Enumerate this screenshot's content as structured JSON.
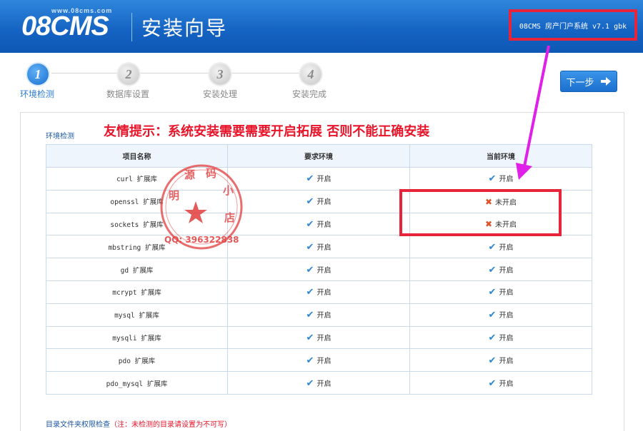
{
  "header": {
    "logo_url_text": "www.08cms.com",
    "logo_text": "08CMS",
    "title": "安装向导",
    "version": "08CMS 房产门户系统 v7.1 gbk"
  },
  "steps": [
    {
      "num": "1",
      "label": "环境检测",
      "active": true
    },
    {
      "num": "2",
      "label": "数据库设置",
      "active": false
    },
    {
      "num": "3",
      "label": "安装处理",
      "active": false
    },
    {
      "num": "4",
      "label": "安装完成",
      "active": false
    }
  ],
  "next_button": {
    "label": "下一步"
  },
  "section": {
    "title": "环境检测",
    "notice": "友情提示：系统安装需要需要开启拓展 否则不能正确安装"
  },
  "table": {
    "headers": [
      "项目名称",
      "要求环境",
      "当前环境"
    ],
    "rows": [
      {
        "name": "curl 扩展库",
        "required": "开启",
        "current": "开启",
        "ok": true
      },
      {
        "name": "openssl 扩展库",
        "required": "开启",
        "current": "未开启",
        "ok": false
      },
      {
        "name": "sockets 扩展库",
        "required": "开启",
        "current": "未开启",
        "ok": false
      },
      {
        "name": "mbstring 扩展库",
        "required": "开启",
        "current": "开启",
        "ok": true
      },
      {
        "name": "gd 扩展库",
        "required": "开启",
        "current": "开启",
        "ok": true
      },
      {
        "name": "mcrypt 扩展库",
        "required": "开启",
        "current": "开启",
        "ok": true
      },
      {
        "name": "mysql 扩展库",
        "required": "开启",
        "current": "开启",
        "ok": true
      },
      {
        "name": "mysqli 扩展库",
        "required": "开启",
        "current": "开启",
        "ok": true
      },
      {
        "name": "pdo 扩展库",
        "required": "开启",
        "current": "开启",
        "ok": true
      },
      {
        "name": "pdo_mysql 扩展库",
        "required": "开启",
        "current": "开启",
        "ok": true
      }
    ]
  },
  "permissions": {
    "title": "目录文件夹权限检查",
    "note": "（注：未检测的目录请设置为不可写）"
  },
  "stamp": {
    "text": "明源码小店",
    "qq": "QQ: 396322838"
  },
  "colors": {
    "header_blue": "#1462c2",
    "accent_red": "#e8243a",
    "check_blue": "#2a87d6",
    "cross_orange": "#e0532a",
    "arrow_magenta": "#e020e8"
  }
}
